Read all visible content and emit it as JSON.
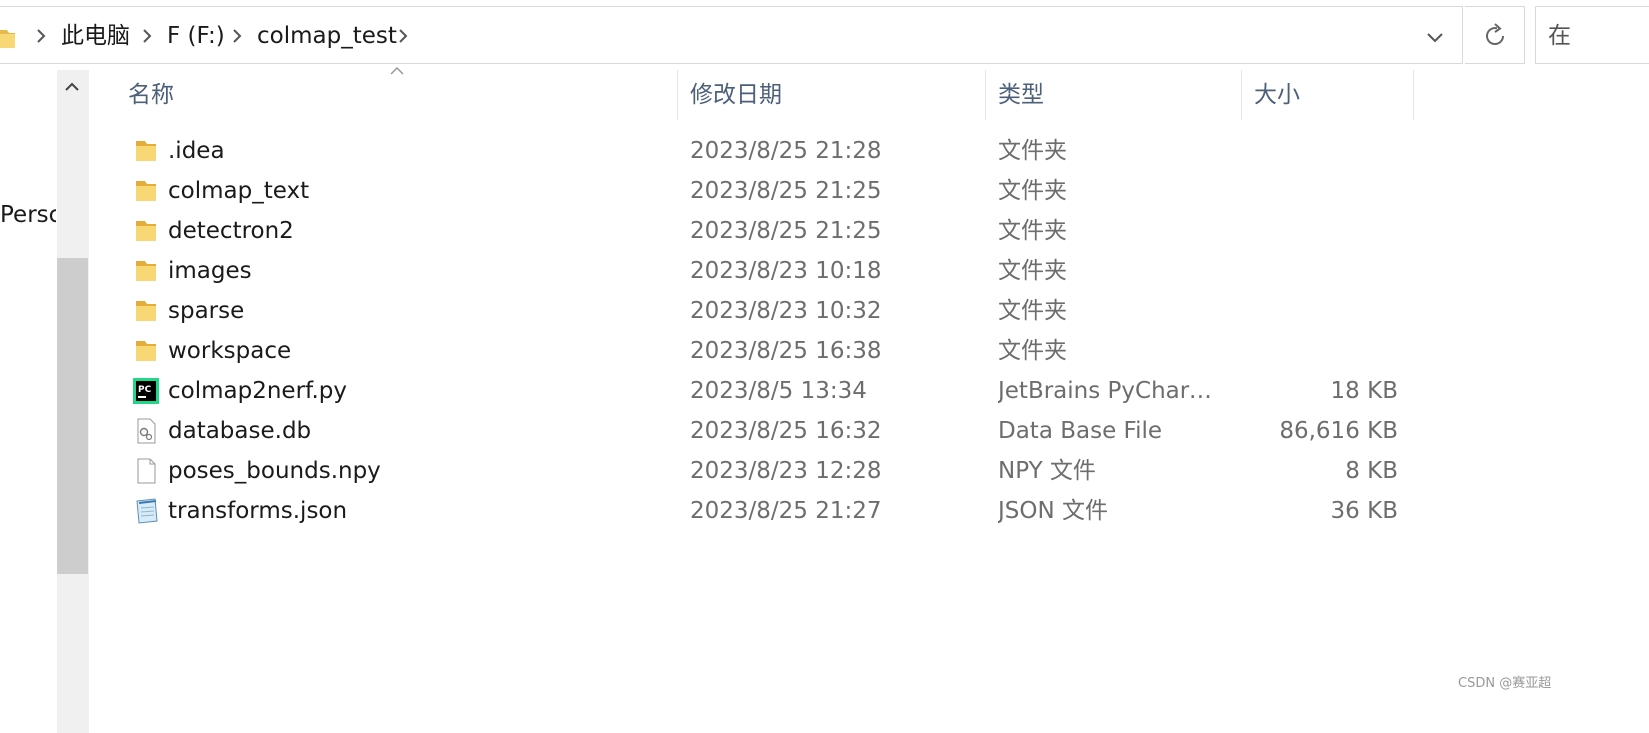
{
  "address_bar": {
    "crumbs": [
      "此电脑",
      "F (F:)",
      "colmap_test"
    ]
  },
  "search": {
    "placeholder_visible": "在"
  },
  "nav_pane": {
    "visible_item": "Persc"
  },
  "columns": {
    "name": "名称",
    "date": "修改日期",
    "type": "类型",
    "size": "大小"
  },
  "files": [
    {
      "name": ".idea",
      "date": "2023/8/25 21:28",
      "type": "文件夹",
      "size": "",
      "icon": "folder-icon"
    },
    {
      "name": "colmap_text",
      "date": "2023/8/25 21:25",
      "type": "文件夹",
      "size": "",
      "icon": "folder-icon"
    },
    {
      "name": "detectron2",
      "date": "2023/8/25 21:25",
      "type": "文件夹",
      "size": "",
      "icon": "folder-icon"
    },
    {
      "name": "images",
      "date": "2023/8/23 10:18",
      "type": "文件夹",
      "size": "",
      "icon": "folder-icon"
    },
    {
      "name": "sparse",
      "date": "2023/8/23 10:32",
      "type": "文件夹",
      "size": "",
      "icon": "folder-icon"
    },
    {
      "name": "workspace",
      "date": "2023/8/25 16:38",
      "type": "文件夹",
      "size": "",
      "icon": "folder-icon"
    },
    {
      "name": "colmap2nerf.py",
      "date": "2023/8/5 13:34",
      "type": "JetBrains PyCharm ...",
      "size": "18 KB",
      "icon": "pycharm-icon"
    },
    {
      "name": "database.db",
      "date": "2023/8/25 16:32",
      "type": "Data Base File",
      "size": "86,616 KB",
      "icon": "settings-file-icon"
    },
    {
      "name": "poses_bounds.npy",
      "date": "2023/8/23 12:28",
      "type": "NPY 文件",
      "size": "8 KB",
      "icon": "blank-file-icon"
    },
    {
      "name": "transforms.json",
      "date": "2023/8/25 21:27",
      "type": "JSON 文件",
      "size": "36 KB",
      "icon": "notepad-icon"
    }
  ],
  "watermark": "CSDN @赛亚超",
  "colors": {
    "header_text": "#4c607a",
    "folder": "#f8d775",
    "scroll_thumb": "#cdcdcd"
  }
}
